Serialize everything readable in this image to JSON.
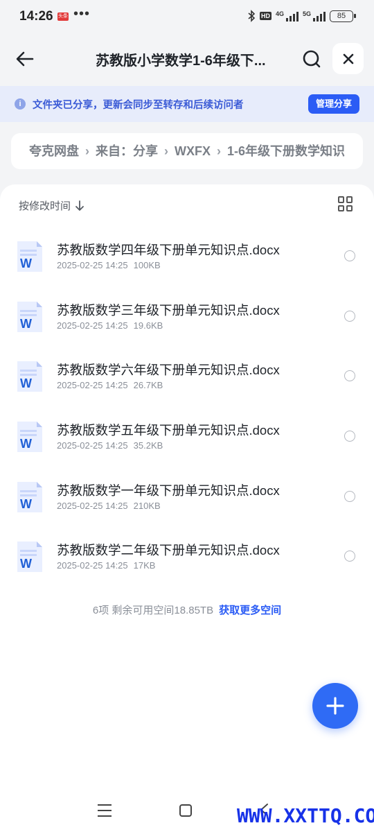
{
  "status_bar": {
    "time": "14:26",
    "badge": "头条",
    "dots": "•••",
    "hd": "HD",
    "net1": "4G",
    "net2": "5G",
    "battery": "85"
  },
  "header": {
    "title": "苏教版小学数学1-6年级下..."
  },
  "notice": {
    "icon": "i",
    "text": "文件夹已分享，更新会同步至转存和后续访问者",
    "button": "管理分享"
  },
  "breadcrumb": {
    "items": [
      "夸克网盘",
      "来自：分享",
      "WXFX",
      "1-6年级下册数学知识"
    ]
  },
  "list": {
    "sort_label": "按修改时间",
    "files": [
      {
        "name": "苏教版数学四年级下册单元知识点.docx",
        "date": "2025-02-25 14:25",
        "size": "100KB"
      },
      {
        "name": "苏教版数学三年级下册单元知识点.docx",
        "date": "2025-02-25 14:25",
        "size": "19.6KB"
      },
      {
        "name": "苏教版数学六年级下册单元知识点.docx",
        "date": "2025-02-25 14:25",
        "size": "26.7KB"
      },
      {
        "name": "苏教版数学五年级下册单元知识点.docx",
        "date": "2025-02-25 14:25",
        "size": "35.2KB"
      },
      {
        "name": "苏教版数学一年级下册单元知识点.docx",
        "date": "2025-02-25 14:25",
        "size": "210KB"
      },
      {
        "name": "苏教版数学二年级下册单元知识点.docx",
        "date": "2025-02-25 14:25",
        "size": "17KB"
      }
    ]
  },
  "footer": {
    "summary": "6项 剩余可用空间18.85TB",
    "link": "获取更多空间"
  },
  "watermark": "WWW.XXTTQ.COM",
  "colors": {
    "accent": "#2b5cf5",
    "notice_bg": "#e7ecfb",
    "word_blue": "#1f5fd6"
  },
  "icons": {
    "back": "arrow-left-icon",
    "search": "search-icon",
    "close": "close-icon",
    "info": "info-icon",
    "sort": "arrow-down-icon",
    "grid": "grid-view-icon",
    "file": "word-doc-icon",
    "fab": "plus-icon"
  }
}
